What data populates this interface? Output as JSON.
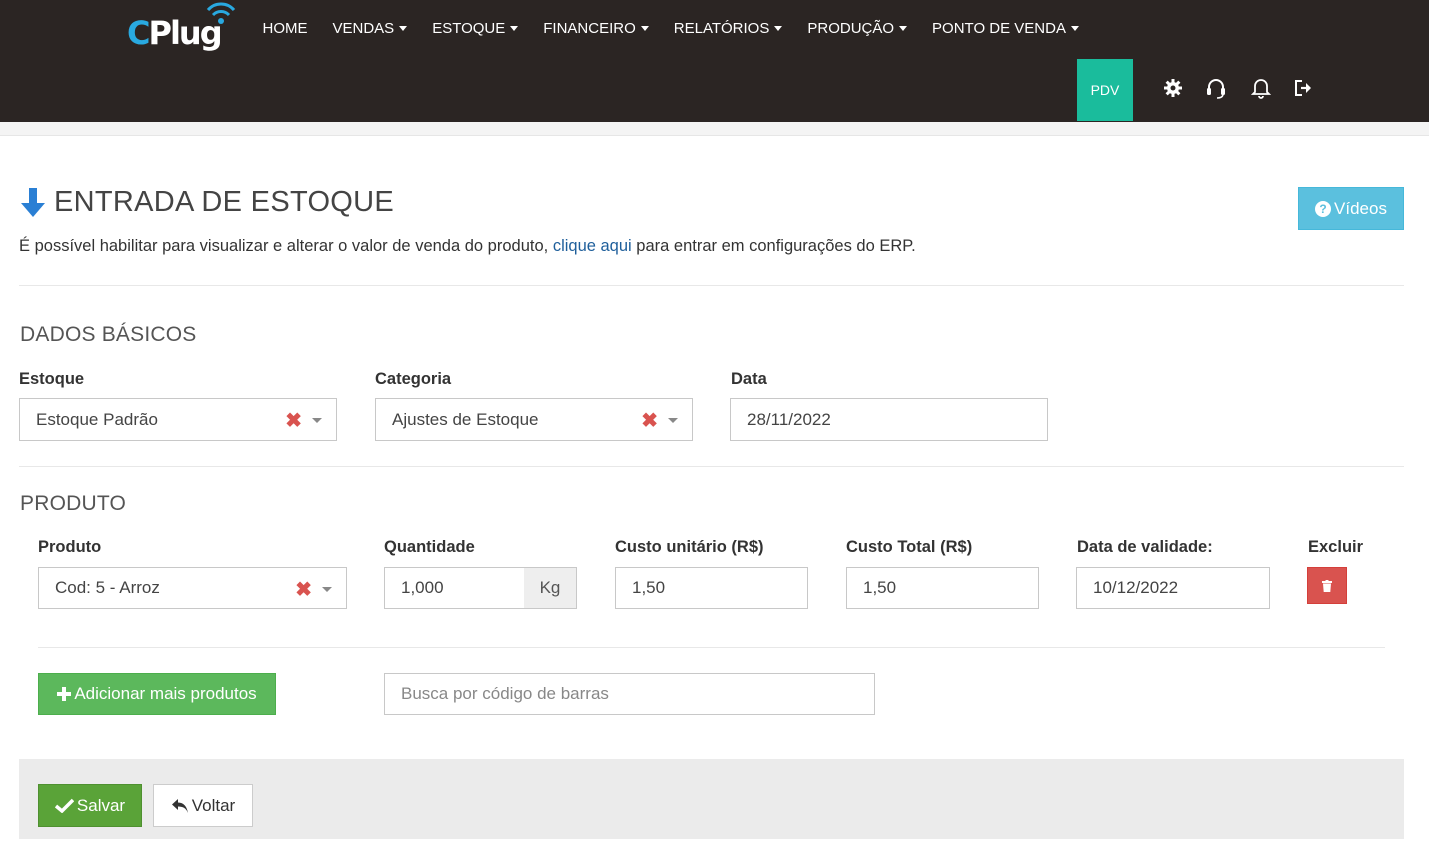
{
  "nav": {
    "logo_text_c": "C",
    "logo_text_rest": "Plug",
    "menu": [
      {
        "label": "HOME"
      },
      {
        "label": "VENDAS"
      },
      {
        "label": "ESTOQUE"
      },
      {
        "label": "FINANCEIRO"
      },
      {
        "label": "RELATÓRIOS"
      },
      {
        "label": "PRODUÇÃO"
      },
      {
        "label": "PONTO DE VENDA"
      }
    ],
    "pdv_label": "PDV",
    "icons": [
      "gear-icon",
      "headset-icon",
      "bell-icon",
      "logout-icon"
    ],
    "accent_color": "#1abc9c"
  },
  "page": {
    "title": "ENTRADA DE ESTOQUE",
    "info_before": "É possível habilitar para visualizar e alterar o valor de venda do produto, ",
    "info_link": "clique aqui",
    "info_after": " para entrar em configurações do ERP.",
    "videos_label": "Vídeos"
  },
  "dados_basicos": {
    "section_title": "DADOS BÁSICOS",
    "estoque_label": "Estoque",
    "estoque_value": "Estoque Padrão",
    "categoria_label": "Categoria",
    "categoria_value": "Ajustes de Estoque",
    "data_label": "Data",
    "data_value": "28/11/2022"
  },
  "produto": {
    "section_title": "PRODUTO",
    "headers": {
      "produto": "Produto",
      "quantidade": "Quantidade",
      "custo_unitario": "Custo unitário (R$)",
      "custo_total": "Custo Total (R$)",
      "validade": "Data de validade:",
      "excluir": "Excluir"
    },
    "row": {
      "produto": "Cod: 5 - Arroz",
      "quantidade": "1,000",
      "unidade": "Kg",
      "custo_unitario": "1,50",
      "custo_total": "1,50",
      "validade": "10/12/2022"
    },
    "add_button": "Adicionar mais produtos",
    "barcode_placeholder": "Busca por código de barras"
  },
  "footer": {
    "save_label": "Salvar",
    "back_label": "Voltar"
  }
}
